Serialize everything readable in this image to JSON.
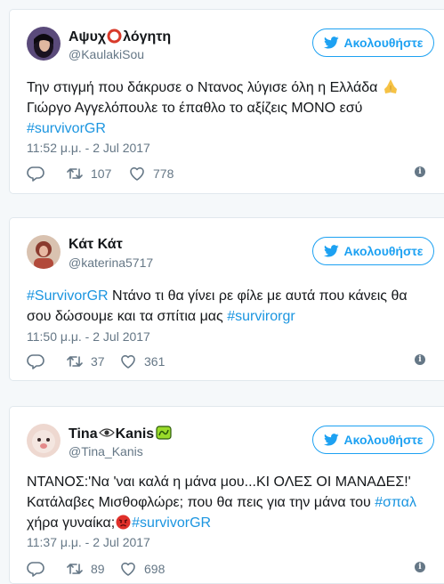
{
  "colors": {
    "background": "#f5f8fa",
    "card": "#ffffff",
    "accent": "#1da1f2",
    "hashtag": "#1b95e0",
    "muted": "#657786"
  },
  "follow_label": "Ακολουθήστε",
  "tweets": [
    {
      "display_name_a": "Αψυχ",
      "display_name_b": "λόγητη",
      "handle": "@KaulakiSou",
      "lines": [
        [
          "Την στιγμή που δάκρυσε ο Ντανος λύγισε όλη η Ελλάδα "
        ],
        [
          "Γιώργο Αγγελόπουλε το έπαθλο το αξίζεις ΜΟΝΟ εσύ"
        ],
        [
          "#survivorGR"
        ]
      ],
      "time": "11:52 μ.μ. - 2 Jul 2017",
      "retweets": "107",
      "likes": "778"
    },
    {
      "display_name": "Κάτ Κάτ",
      "handle": "@katerina5717",
      "line1_tag": "#SurvivorGR",
      "line1_text": " Ντάνο τι θα γίνει ρε φίλε με αυτά που κάνεις θα",
      "line2_text": "σου δώσουμε και τα σπίτια μας ",
      "line2_tag": "#survirorgr",
      "time": "11:50 μ.μ. - 2 Jul 2017",
      "retweets": "37",
      "likes": "361"
    },
    {
      "display_name_a": "Tina",
      "display_name_b": "Kanis",
      "handle": "@Tina_Kanis",
      "line1_text": "ΝΤΑΝΟΣ:'Να 'ναι καλά η μάνα μου...ΚΙ ΟΛΕΣ ΟΙ ΜΑΝΑΔΕΣ!'",
      "line2_text": "Κατάλαβες Μισθοφλώρε; που θα πεις για την μάνα του ",
      "line2_tag": "#σπαλ",
      "line3_text": "χήρα γυναίκα;",
      "line3_tag": "#survivorGR",
      "time": "11:37 μ.μ. - 2 Jul 2017",
      "retweets": "89",
      "likes": "698"
    }
  ]
}
